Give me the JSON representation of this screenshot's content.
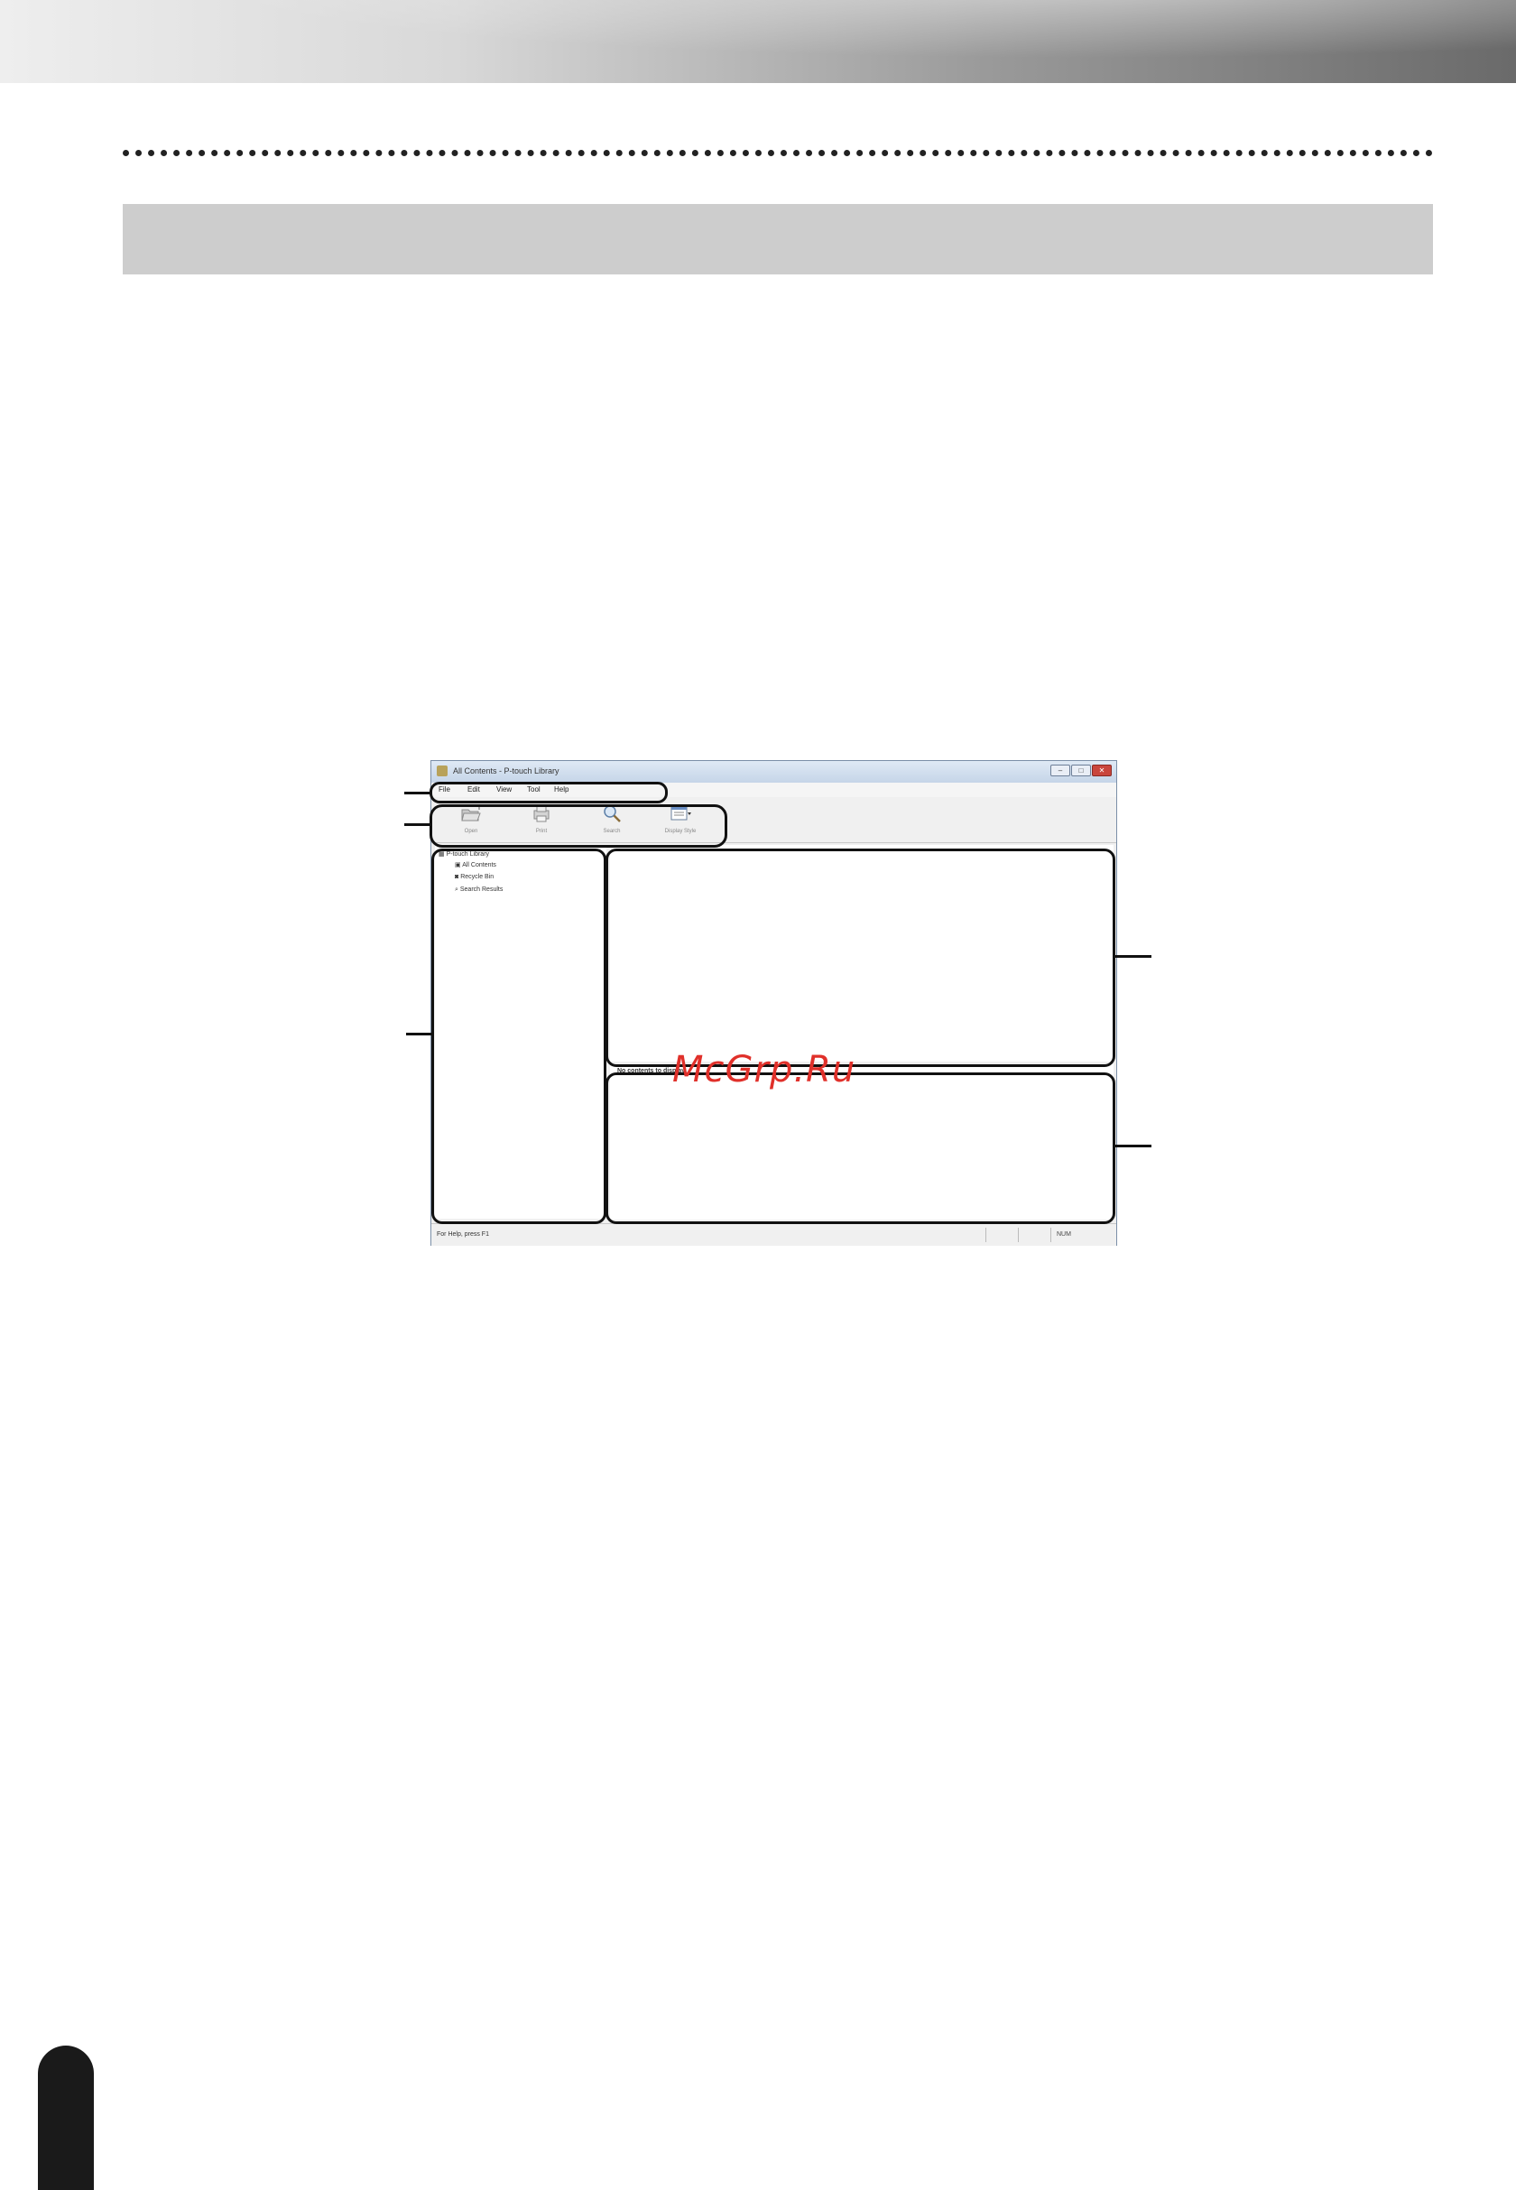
{
  "window": {
    "title": "All Contents - P-touch Library",
    "buttons": {
      "minimize": "–",
      "maximize": "□",
      "close": "✕"
    }
  },
  "menu": [
    {
      "label": "File"
    },
    {
      "label": "Edit"
    },
    {
      "label": "View"
    },
    {
      "label": "Tool"
    },
    {
      "label": "Help"
    }
  ],
  "toolbar": [
    {
      "label": "Open",
      "icon": "open-folder-icon"
    },
    {
      "label": "Print",
      "icon": "print-icon"
    },
    {
      "label": "Search",
      "icon": "search-icon"
    },
    {
      "label": "Display Style",
      "icon": "display-style-icon"
    }
  ],
  "tree": {
    "root": "P-touch Library",
    "items": [
      "All Contents",
      "Recycle Bin",
      "Search Results"
    ]
  },
  "preview": {
    "text": "No contents to display"
  },
  "status": {
    "help": "For Help, press F1",
    "num": "NUM"
  },
  "watermark": "McGrp.Ru",
  "colors": {
    "selection": "#3b8de0",
    "watermark": "#e0302a",
    "section_bar": "#cdcdcd"
  }
}
